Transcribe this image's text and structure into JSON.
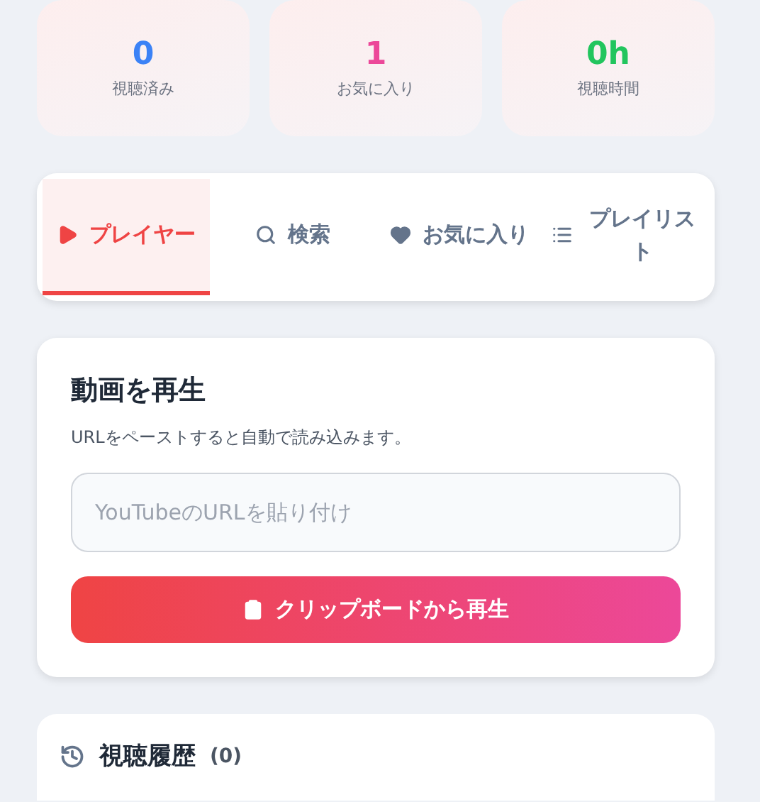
{
  "stats": [
    {
      "value": "0",
      "label": "視聴済み",
      "color": "#3b82f6"
    },
    {
      "value": "1",
      "label": "お気に入り",
      "color": "#ec4899"
    },
    {
      "value": "0h",
      "label": "視聴時間",
      "color": "#22c55e"
    }
  ],
  "tabs": [
    {
      "label": "プレイヤー",
      "kind": "play",
      "selected": true
    },
    {
      "label": "検索",
      "kind": "search",
      "selected": false
    },
    {
      "label": "お気に入り",
      "kind": "heart",
      "selected": false
    },
    {
      "label": "プレイリスト",
      "kind": "list",
      "selected": false
    }
  ],
  "player": {
    "title": "動画を再生",
    "description": "URLをペーストすると自動で読み込みます。",
    "url_field": {
      "placeholder": "YouTubeのURLを貼り付け"
    },
    "paste_button": "クリップボードから再生"
  },
  "history": {
    "title": "視聴履歴",
    "count": "(0)"
  }
}
